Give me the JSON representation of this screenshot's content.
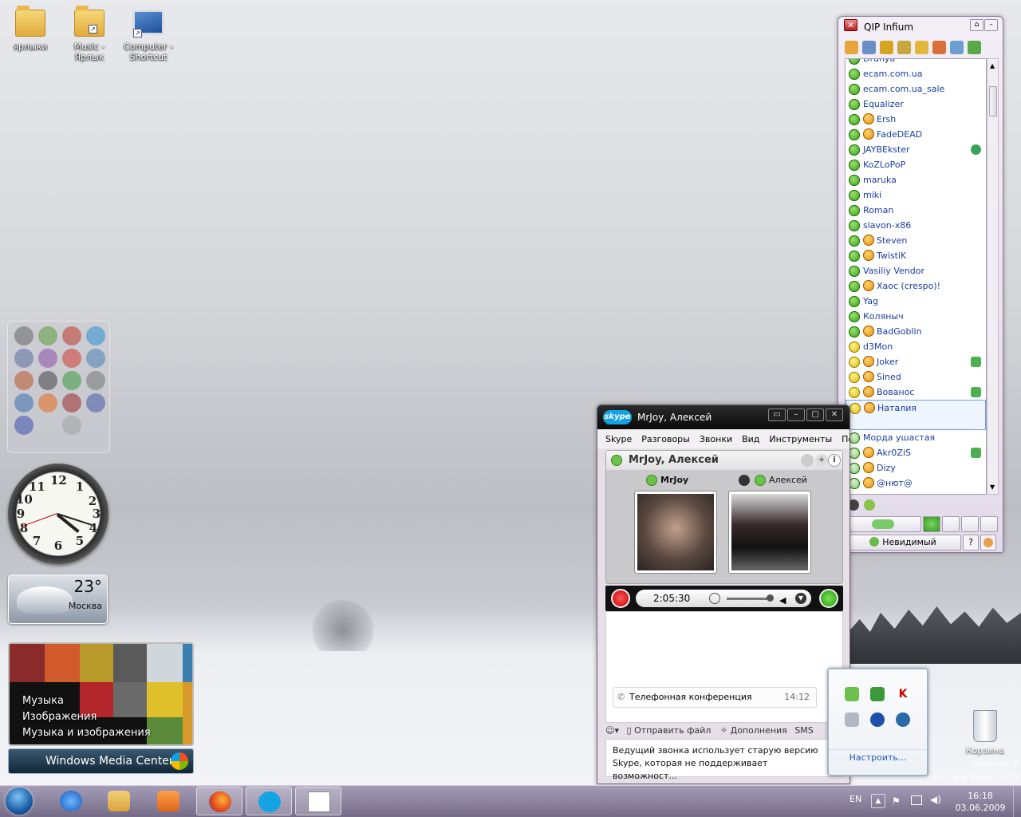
{
  "desktop": {
    "icons": [
      {
        "label": "ярлыки",
        "label2": ""
      },
      {
        "label": "Music -",
        "label2": "Ярлык"
      },
      {
        "label": "Computer -",
        "label2": "Shortcut"
      }
    ],
    "recycle_bin": "Корзина",
    "watermark_line1": "Windows 7",
    "watermark_line2": "on copy. Build 7100"
  },
  "gadgets": {
    "clock": {
      "time": "16:18",
      "numbers": [
        "12",
        "1",
        "2",
        "3",
        "4",
        "5",
        "6",
        "7",
        "8",
        "9",
        "10",
        "11"
      ]
    },
    "weather": {
      "temperature": "23°",
      "city": "Москва"
    },
    "media_center": {
      "menu": [
        "Музыка",
        "Изображения",
        "Музыка и изображения"
      ],
      "bar_label": "Windows Media Center"
    }
  },
  "qip": {
    "title": "QIP Infium",
    "contacts": [
      {
        "name": "Drunya",
        "status": "online",
        "avatar": false,
        "right": ""
      },
      {
        "name": "ecam.com.ua",
        "status": "online",
        "avatar": false,
        "right": ""
      },
      {
        "name": "ecam.com.ua_sale",
        "status": "online",
        "avatar": false,
        "right": ""
      },
      {
        "name": "Equalizer",
        "status": "online",
        "avatar": false,
        "right": ""
      },
      {
        "name": "Ersh",
        "status": "online",
        "avatar": true,
        "right": ""
      },
      {
        "name": "FadeDEAD",
        "status": "online",
        "avatar": true,
        "right": ""
      },
      {
        "name": "JAYBEkster",
        "status": "online",
        "avatar": false,
        "right": "eye"
      },
      {
        "name": "KoZLoPoP",
        "status": "online",
        "avatar": false,
        "right": ""
      },
      {
        "name": "maruka",
        "status": "online",
        "avatar": false,
        "right": ""
      },
      {
        "name": "miki",
        "status": "online",
        "avatar": false,
        "right": ""
      },
      {
        "name": "Roman",
        "status": "online",
        "avatar": false,
        "right": ""
      },
      {
        "name": "slavon-x86",
        "status": "online",
        "avatar": false,
        "right": ""
      },
      {
        "name": "Steven",
        "status": "online",
        "avatar": true,
        "right": ""
      },
      {
        "name": "TwistiK",
        "status": "online",
        "avatar": true,
        "right": ""
      },
      {
        "name": "Vasiliy Vendor",
        "status": "online",
        "avatar": false,
        "right": ""
      },
      {
        "name": "Хаос (crespo)!",
        "status": "online",
        "avatar": true,
        "right": ""
      },
      {
        "name": "Yag",
        "status": "online",
        "avatar": false,
        "right": ""
      },
      {
        "name": "Коляныч",
        "status": "online",
        "avatar": false,
        "right": ""
      },
      {
        "name": "BadGoblin",
        "status": "online",
        "avatar": true,
        "right": ""
      },
      {
        "name": "d3Mon",
        "status": "away",
        "avatar": false,
        "right": ""
      },
      {
        "name": "Joker",
        "status": "away",
        "avatar": true,
        "right": "phone"
      },
      {
        "name": "Sined",
        "status": "away",
        "avatar": true,
        "right": ""
      },
      {
        "name": "Вованос",
        "status": "away",
        "avatar": true,
        "right": "phone"
      },
      {
        "name": "Наталия",
        "status": "away",
        "avatar": true,
        "right": "",
        "selected": true
      },
      {
        "name": "Морда ушастая",
        "status": "other",
        "avatar": false,
        "right": ""
      },
      {
        "name": "Akr0ZiS",
        "status": "other",
        "avatar": true,
        "right": "phone"
      },
      {
        "name": "Dizy",
        "status": "other",
        "avatar": true,
        "right": ""
      },
      {
        "name": "@нют@",
        "status": "other",
        "avatar": true,
        "right": ""
      }
    ],
    "status_label": "Невидимый"
  },
  "skype": {
    "title": "MrJoy, Алексей",
    "menu": [
      "Skype",
      "Разговоры",
      "Звонки",
      "Вид",
      "Инструменты",
      "Помощь"
    ],
    "conversation_title": "MrJoy, Алексей",
    "participants": [
      "MrJoy",
      "Алексей"
    ],
    "call_time": "2:05:30",
    "event_label": "Телефонная конференция",
    "event_time": "14:12",
    "tools": [
      "Отправить файл",
      "Дополнения",
      "SMS"
    ],
    "warning": "Ведущий звонка использует старую версию Skype, которая не поддерживает возможност..."
  },
  "tray_popup": {
    "customize": "Настроить..."
  },
  "taskbar": {
    "language": "EN",
    "time": "16:18",
    "date": "03.06.2009"
  }
}
